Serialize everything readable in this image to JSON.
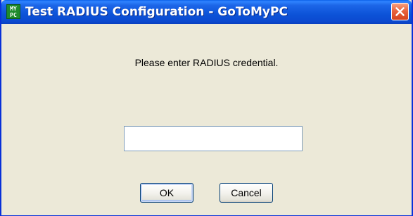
{
  "window": {
    "title": "Test RADIUS Configuration - GoToMyPC",
    "app_icon_text_top": "MY",
    "app_icon_text_bottom": "PC"
  },
  "dialog": {
    "prompt": "Please enter RADIUS credential.",
    "credential_value": "",
    "ok_label": "OK",
    "cancel_label": "Cancel"
  },
  "colors": {
    "titlebar": "#0b4ad0",
    "close_button": "#e9643e",
    "dialog_background": "#ece9d8"
  },
  "icons": {
    "app": "gotomypc-app-icon",
    "close": "close-icon"
  }
}
